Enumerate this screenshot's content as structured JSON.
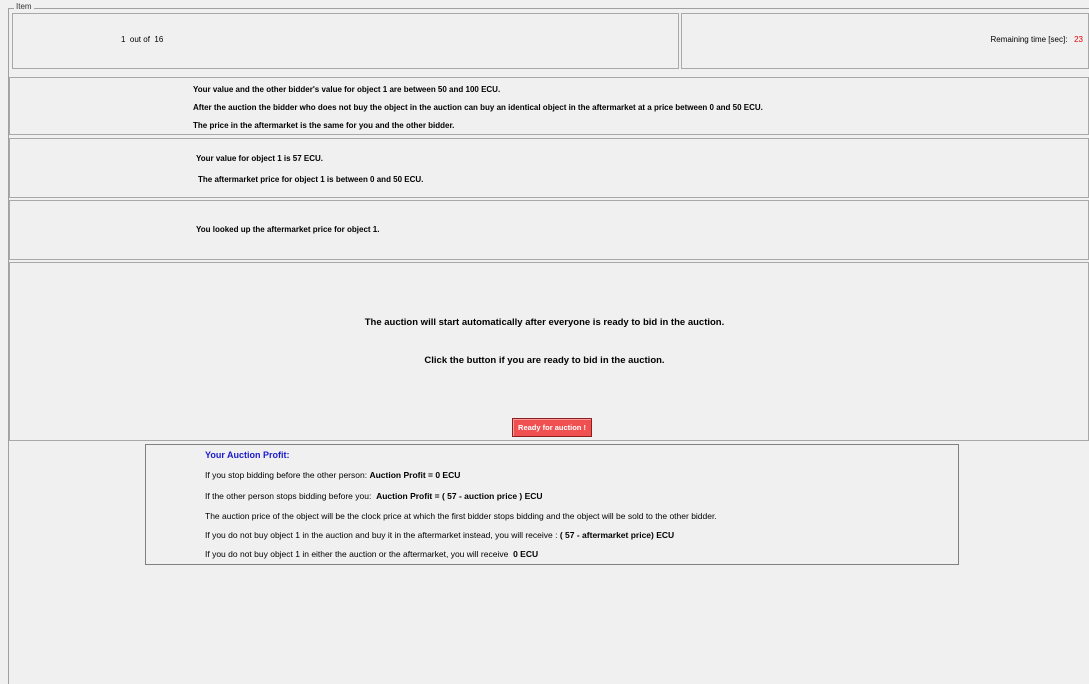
{
  "item_legend": "Item",
  "progress": {
    "current": "1",
    "out_of_label": "out of",
    "total": "16"
  },
  "timer": {
    "label": "Remaining time [sec]:",
    "value": "23"
  },
  "info": {
    "line1": "Your value and the other bidder's value for object 1 are between 50 and 100 ECU.",
    "line2": "After the auction the bidder who does not buy the object in the auction can buy an identical object in the aftermarket at a price between 0 and 50 ECU.",
    "line3": "The price in the aftermarket is the same for you and the other bidder."
  },
  "value_panel": {
    "line1": "Your value for object 1 is 57 ECU.",
    "line2": "The aftermarket price for object 1 is between 0 and 50 ECU."
  },
  "lookup_panel": {
    "line1": "You looked up the aftermarket price for object 1."
  },
  "auction_panel": {
    "line1": "The auction will start automatically after everyone is ready to bid in the auction.",
    "line2": "Click the button if you are ready to bid in the auction.",
    "button_label": "Ready for auction !"
  },
  "profit": {
    "title": "Your Auction Profit:",
    "l1_text": "If you stop bidding before the other person:",
    "l1_bold": "Auction Profit = 0 ECU",
    "l2_text": "If the other person stops bidding before you:",
    "l2_bold": "Auction Profit = ( 57 - auction price ) ECU",
    "l3_text": "The auction price of the object will be the clock price at which the first bidder stops bidding and the object will be sold to the other bidder.",
    "l4_text": "If you do not buy object 1 in the auction and buy it in the aftermarket instead, you will receive :",
    "l4_bold": "( 57 - aftermarket price) ECU",
    "l5_text": "If you do not buy object 1 in either the auction or the aftermarket, you will receive",
    "l5_bold": "0 ECU"
  }
}
